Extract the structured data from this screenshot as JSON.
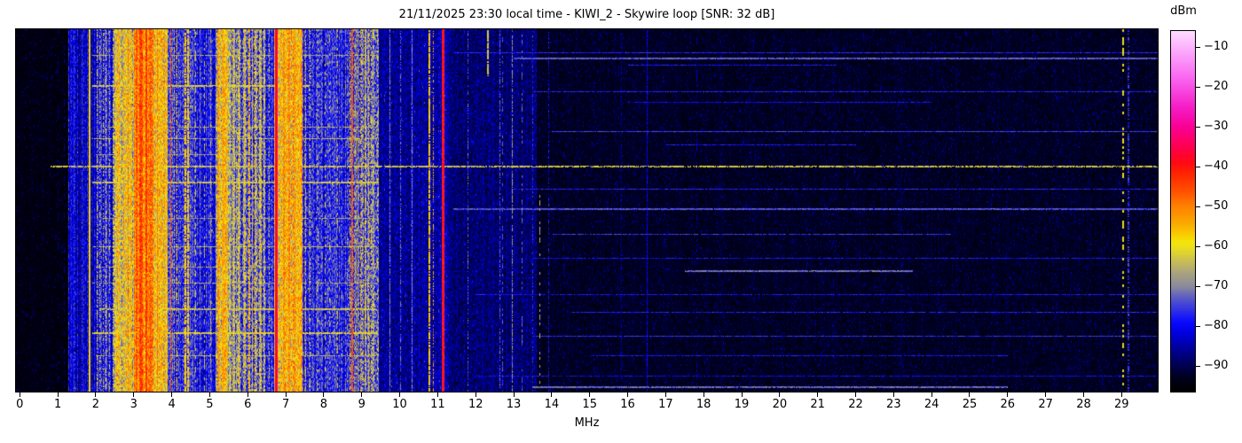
{
  "chart_data": {
    "type": "heatmap",
    "title": "21/11/2025 23:30 local time - KIWI_2 - Skywire loop [SNR: 32 dB]",
    "xlabel": "MHz",
    "x_ticks": [
      0,
      1,
      2,
      3,
      4,
      5,
      6,
      7,
      8,
      9,
      10,
      11,
      12,
      13,
      14,
      15,
      16,
      17,
      18,
      19,
      20,
      21,
      22,
      23,
      24,
      25,
      26,
      27,
      28,
      29
    ],
    "x_range": [
      -0.1,
      29.95
    ],
    "grid": false,
    "colorbar": {
      "label": "dBm",
      "vmin": -96.4,
      "vmax": -6.0,
      "ticks": [
        {
          "value": -10,
          "label": "−10"
        },
        {
          "value": -20,
          "label": "−20"
        },
        {
          "value": -30,
          "label": "−30"
        },
        {
          "value": -40,
          "label": "−40"
        },
        {
          "value": -50,
          "label": "−50"
        },
        {
          "value": -60,
          "label": "−60"
        },
        {
          "value": -70,
          "label": "−70"
        },
        {
          "value": -80,
          "label": "−80"
        },
        {
          "value": -90,
          "label": "−90"
        }
      ]
    },
    "colormap_stops": [
      [
        -96.4,
        "#000000"
      ],
      [
        -93,
        "#00001e"
      ],
      [
        -90,
        "#000050"
      ],
      [
        -86,
        "#000096"
      ],
      [
        -82,
        "#0000dc"
      ],
      [
        -79,
        "#0a0aff"
      ],
      [
        -76,
        "#3232e6"
      ],
      [
        -73,
        "#5a5ac8"
      ],
      [
        -70,
        "#8c8c9b"
      ],
      [
        -67,
        "#a8a182"
      ],
      [
        -64,
        "#c6bc5a"
      ],
      [
        -61,
        "#e6da28"
      ],
      [
        -59,
        "#f5e60a"
      ],
      [
        -57,
        "#fccc00"
      ],
      [
        -54,
        "#faa800"
      ],
      [
        -50,
        "#ff8200"
      ],
      [
        -46,
        "#ff5000"
      ],
      [
        -42,
        "#ff2800"
      ],
      [
        -39,
        "#ff0a14"
      ],
      [
        -35,
        "#ff0050"
      ],
      [
        -30,
        "#fa0096"
      ],
      [
        -25,
        "#f51ec8"
      ],
      [
        -18,
        "#fa64f0"
      ],
      [
        -11,
        "#fcaafc"
      ],
      [
        -6,
        "#ffdcff"
      ]
    ],
    "seed": 1337,
    "noise_regions_fields": [
      "f0_mhz",
      "f1_mhz",
      "base_dbm",
      "pix_var_db",
      "col_var_db",
      "speckle_prob",
      "speckle_amp_db"
    ],
    "noise_regions": [
      [
        -0.1,
        1.28,
        -94.5,
        1.5,
        0.6,
        0.06,
        9
      ],
      [
        1.28,
        2.04,
        -83,
        5,
        6,
        0.05,
        6
      ],
      [
        2.04,
        2.48,
        -79,
        6,
        5,
        0.08,
        8
      ],
      [
        2.48,
        3.02,
        -62,
        9,
        6,
        0,
        0
      ],
      [
        3.02,
        3.52,
        -49,
        7,
        5,
        0,
        0
      ],
      [
        3.52,
        3.9,
        -58,
        8,
        5,
        0,
        0
      ],
      [
        3.9,
        4.06,
        -73,
        7,
        4,
        0,
        0
      ],
      [
        4.06,
        4.78,
        -77,
        7,
        5,
        0.08,
        8
      ],
      [
        4.78,
        5.16,
        -78,
        6,
        5,
        0.08,
        8
      ],
      [
        5.16,
        5.52,
        -62,
        9,
        7,
        0,
        0
      ],
      [
        5.52,
        5.82,
        -68,
        9,
        7,
        0,
        0
      ],
      [
        5.82,
        6.48,
        -70,
        10,
        8,
        0,
        0
      ],
      [
        6.48,
        6.7,
        -77,
        7,
        5,
        0,
        0
      ],
      [
        6.7,
        6.84,
        -62,
        8,
        4,
        0,
        0
      ],
      [
        6.84,
        7.46,
        -57,
        9,
        7,
        0,
        0
      ],
      [
        7.46,
        8.62,
        -78,
        7,
        5,
        0.06,
        8
      ],
      [
        8.62,
        9.46,
        -72,
        9,
        7,
        0,
        0
      ],
      [
        9.46,
        11.02,
        -86,
        4.5,
        2,
        0.12,
        8
      ],
      [
        11.02,
        11.3,
        -84,
        5,
        2,
        0.1,
        8
      ],
      [
        11.3,
        13.62,
        -88.5,
        4,
        1.5,
        0.1,
        7
      ],
      [
        13.62,
        29.96,
        -93,
        2.2,
        0.8,
        0.09,
        8
      ]
    ],
    "vertical_signals_fields": [
      "mhz",
      "width_px",
      "level_dbm",
      "jitter_db",
      "duty",
      "y0_frac",
      "y1_frac"
    ],
    "vertical_signals": [
      [
        1.0,
        1,
        -88,
        3,
        0.3
      ],
      [
        1.15,
        1,
        -87,
        3,
        0.3
      ],
      [
        1.45,
        1,
        -76,
        4,
        0.5
      ],
      [
        1.62,
        1,
        -74,
        4,
        0.5
      ],
      [
        1.84,
        2,
        -58,
        3,
        1.0
      ],
      [
        2.02,
        1,
        -63,
        5,
        0.6
      ],
      [
        2.1,
        1,
        -61,
        5,
        0.55
      ],
      [
        2.18,
        1,
        -64,
        5,
        0.5
      ],
      [
        2.26,
        1,
        -60,
        5,
        0.6
      ],
      [
        2.35,
        1,
        -63,
        5,
        0.5
      ],
      [
        2.44,
        1,
        -61,
        5,
        0.55
      ],
      [
        2.52,
        1,
        -58,
        5,
        0.6
      ],
      [
        2.72,
        1,
        -52,
        6,
        0.7
      ],
      [
        2.85,
        1,
        -50,
        6,
        0.7
      ],
      [
        3.08,
        2,
        -45,
        6,
        0.8
      ],
      [
        3.2,
        2,
        -44,
        6,
        0.85
      ],
      [
        3.33,
        2,
        -45,
        6,
        0.8
      ],
      [
        3.46,
        2,
        -46,
        6,
        0.8
      ],
      [
        3.62,
        1,
        -50,
        6,
        0.7
      ],
      [
        3.8,
        1,
        -52,
        6,
        0.65
      ],
      [
        3.97,
        1,
        -47,
        5,
        0.9
      ],
      [
        4.05,
        1,
        -60,
        5,
        0.5
      ],
      [
        4.13,
        1,
        -59,
        5,
        0.6
      ],
      [
        4.35,
        2,
        -57,
        4,
        0.8
      ],
      [
        4.44,
        2,
        -57,
        4,
        0.8
      ],
      [
        4.62,
        1,
        -62,
        5,
        0.45
      ],
      [
        4.85,
        1,
        -64,
        5,
        0.4
      ],
      [
        5.02,
        1,
        -63,
        5,
        0.45
      ],
      [
        5.22,
        2,
        -52,
        6,
        0.8
      ],
      [
        5.35,
        2,
        -54,
        6,
        0.75
      ],
      [
        5.62,
        1,
        -60,
        6,
        0.6
      ],
      [
        5.74,
        1,
        -62,
        6,
        0.55
      ],
      [
        5.92,
        1,
        -58,
        6,
        0.65
      ],
      [
        6.05,
        2,
        -55,
        6,
        0.7
      ],
      [
        6.18,
        1,
        -58,
        6,
        0.6
      ],
      [
        6.3,
        1,
        -57,
        6,
        0.6
      ],
      [
        6.55,
        1,
        -62,
        5,
        0.5
      ],
      [
        6.74,
        3,
        -37,
        3,
        1.0
      ],
      [
        6.86,
        2,
        -55,
        5,
        0.85
      ],
      [
        6.95,
        2,
        -52,
        6,
        0.8
      ],
      [
        7.08,
        2,
        -50,
        6,
        0.8
      ],
      [
        7.22,
        2,
        -53,
        6,
        0.75
      ],
      [
        7.35,
        1,
        -56,
        6,
        0.65
      ],
      [
        7.52,
        1,
        -60,
        5,
        0.55
      ],
      [
        7.63,
        1,
        -62,
        5,
        0.5
      ],
      [
        7.85,
        1,
        -64,
        5,
        0.35
      ],
      [
        8.02,
        1,
        -63,
        5,
        0.3
      ],
      [
        8.15,
        1,
        -65,
        5,
        0.3
      ],
      [
        8.35,
        1,
        -64,
        5,
        0.3
      ],
      [
        8.68,
        1,
        -58,
        5,
        0.6
      ],
      [
        8.76,
        2,
        -47,
        5,
        0.85
      ],
      [
        8.9,
        1,
        -57,
        5,
        0.6
      ],
      [
        8.99,
        1,
        -56,
        5,
        0.65
      ],
      [
        9.08,
        1,
        -58,
        5,
        0.6
      ],
      [
        9.16,
        1,
        -57,
        5,
        0.6
      ],
      [
        9.24,
        1,
        -60,
        5,
        0.5
      ],
      [
        9.4,
        1,
        -62,
        5,
        0.45
      ],
      [
        9.74,
        1,
        -70,
        4,
        0.8
      ],
      [
        10.0,
        1,
        -72,
        4,
        0.6
      ],
      [
        10.32,
        1,
        -70,
        4,
        0.8
      ],
      [
        10.78,
        2,
        -57,
        5,
        0.85
      ],
      [
        10.88,
        1,
        -54,
        6,
        0.5
      ],
      [
        11.14,
        3,
        -40,
        4,
        1.0
      ],
      [
        11.79,
        1,
        -73,
        4,
        0.5
      ],
      [
        12.33,
        2,
        -63,
        3,
        0.9,
        0,
        0.13
      ],
      [
        12.62,
        1,
        -72,
        4,
        0.5
      ],
      [
        12.7,
        1,
        -74,
        4,
        0.4
      ],
      [
        12.96,
        1,
        -68,
        4,
        0.7
      ],
      [
        13.22,
        1,
        -73,
        4,
        0.45
      ],
      [
        13.49,
        1,
        -76,
        4,
        0.5
      ],
      [
        13.68,
        1,
        -66,
        4,
        0.45,
        0.45,
        1
      ],
      [
        13.91,
        1,
        -78,
        4,
        0.5
      ],
      [
        14.3,
        1,
        -86,
        3,
        0.3
      ],
      [
        15.1,
        1,
        -86,
        3,
        0.25
      ],
      [
        15.83,
        1,
        -84,
        3,
        0.55
      ],
      [
        16.5,
        1,
        -81,
        3,
        0.9
      ],
      [
        17.8,
        1,
        -86,
        3,
        0.25
      ],
      [
        19.3,
        1,
        -87,
        3,
        0.2
      ],
      [
        21.4,
        1,
        -86,
        3,
        0.2
      ],
      [
        23.2,
        1,
        -87,
        3,
        0.2
      ],
      [
        25.6,
        1,
        -86,
        3,
        0.2
      ],
      [
        27.2,
        1,
        -87,
        3,
        0.2
      ],
      [
        29.05,
        2,
        -60,
        3,
        0.32
      ],
      [
        29.18,
        2,
        -76,
        4,
        0.5
      ]
    ],
    "horizontal_events_fields": [
      "y_frac",
      "f0_mhz",
      "f1_mhz",
      "level_dbm",
      "jitter_db",
      "duty",
      "height_px"
    ],
    "horizontal_events": [
      [
        0.07,
        1.9,
        9.4,
        -66,
        4,
        0.9,
        1
      ],
      [
        0.155,
        1.9,
        7.6,
        -63,
        4,
        0.9,
        2
      ],
      [
        0.27,
        2.3,
        9.4,
        -66,
        4,
        0.85,
        1
      ],
      [
        0.3,
        1.9,
        9.4,
        -64,
        4,
        0.9,
        1
      ],
      [
        0.345,
        2.0,
        6.5,
        -67,
        4,
        0.85,
        1
      ],
      [
        0.42,
        1.9,
        9.4,
        -63,
        4,
        0.9,
        2
      ],
      [
        0.52,
        2.2,
        9.4,
        -66,
        4,
        0.85,
        1
      ],
      [
        0.6,
        1.9,
        9.4,
        -64,
        4,
        0.9,
        1
      ],
      [
        0.655,
        2.0,
        7.2,
        -66,
        4,
        0.85,
        1
      ],
      [
        0.7,
        1.9,
        9.4,
        -67,
        4,
        0.8,
        1
      ],
      [
        0.77,
        2.1,
        9.4,
        -64,
        4,
        0.9,
        2
      ],
      [
        0.835,
        1.9,
        9.4,
        -62,
        4,
        0.9,
        2
      ],
      [
        0.9,
        2.0,
        9.4,
        -65,
        4,
        0.85,
        1
      ],
      [
        0.377,
        0.8,
        29.96,
        -63,
        5,
        0.8,
        2
      ],
      [
        0.064,
        11.4,
        29.96,
        -77,
        3,
        0.95,
        1
      ],
      [
        0.078,
        13.0,
        29.96,
        -73,
        3,
        0.95,
        2
      ],
      [
        0.098,
        16.0,
        21.5,
        -78,
        3,
        0.9,
        1
      ],
      [
        0.17,
        13.5,
        29.96,
        -77,
        3,
        0.9,
        1
      ],
      [
        0.2,
        16.0,
        24.0,
        -79,
        3,
        0.9,
        1
      ],
      [
        0.28,
        14.0,
        29.96,
        -75,
        3,
        0.95,
        1
      ],
      [
        0.318,
        17.0,
        22.0,
        -78,
        3,
        0.9,
        1
      ],
      [
        0.44,
        13.0,
        29.96,
        -77,
        3,
        0.9,
        1
      ],
      [
        0.494,
        11.4,
        29.96,
        -74,
        3,
        0.95,
        2
      ],
      [
        0.565,
        14.0,
        24.5,
        -75,
        3,
        0.9,
        1
      ],
      [
        0.63,
        13.5,
        29.96,
        -78,
        3,
        0.85,
        1
      ],
      [
        0.665,
        17.5,
        23.5,
        -72,
        3,
        0.95,
        2
      ],
      [
        0.73,
        12.0,
        29.96,
        -78,
        3,
        0.85,
        1
      ],
      [
        0.78,
        14.5,
        29.96,
        -77,
        3,
        0.9,
        1
      ],
      [
        0.845,
        13.5,
        29.96,
        -76,
        3,
        0.9,
        1
      ],
      [
        0.9,
        15.0,
        26.0,
        -78,
        3,
        0.85,
        1
      ],
      [
        0.955,
        12.0,
        29.96,
        -79,
        3,
        0.8,
        1
      ],
      [
        0.985,
        13.5,
        26.0,
        -72,
        3,
        0.95,
        2
      ]
    ]
  }
}
